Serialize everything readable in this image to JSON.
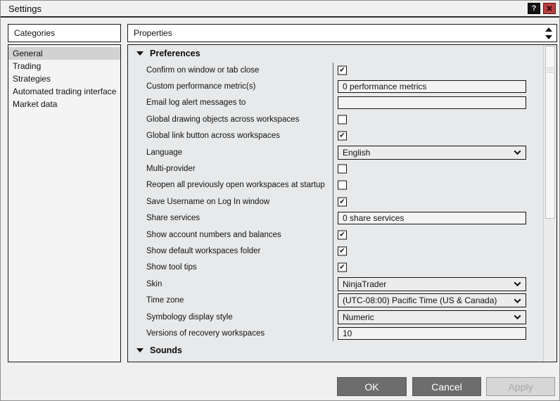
{
  "window": {
    "title": "Settings",
    "help_label": "?",
    "close_label": "✕"
  },
  "sidebar": {
    "header": "Categories",
    "items": [
      {
        "label": "General",
        "selected": true
      },
      {
        "label": "Trading",
        "selected": false
      },
      {
        "label": "Strategies",
        "selected": false
      },
      {
        "label": "Automated trading interface",
        "selected": false
      },
      {
        "label": "Market data",
        "selected": false
      }
    ]
  },
  "properties": {
    "header": "Properties",
    "sections": [
      {
        "title": "Preferences",
        "expanded": true,
        "rows": [
          {
            "label": "Confirm on window or tab close",
            "control": "checkbox",
            "value": true
          },
          {
            "label": "Custom performance metric(s)",
            "control": "text",
            "value": "0 performance metrics"
          },
          {
            "label": "Email log alert messages to",
            "control": "text",
            "value": ""
          },
          {
            "label": "Global drawing objects across workspaces",
            "control": "checkbox",
            "value": false
          },
          {
            "label": "Global link button across workspaces",
            "control": "checkbox",
            "value": true
          },
          {
            "label": "Language",
            "control": "select",
            "value": "English"
          },
          {
            "label": "Multi-provider",
            "control": "checkbox",
            "value": false
          },
          {
            "label": "Reopen all previously open workspaces at startup",
            "control": "checkbox",
            "value": false
          },
          {
            "label": "Save Username on Log In window",
            "control": "checkbox",
            "value": true
          },
          {
            "label": "Share services",
            "control": "text",
            "value": "0 share services"
          },
          {
            "label": "Show account numbers and balances",
            "control": "checkbox",
            "value": true
          },
          {
            "label": "Show default workspaces folder",
            "control": "checkbox",
            "value": true
          },
          {
            "label": "Show tool tips",
            "control": "checkbox",
            "value": true
          },
          {
            "label": "Skin",
            "control": "select",
            "value": "NinjaTrader"
          },
          {
            "label": "Time zone",
            "control": "select",
            "value": "(UTC-08:00) Pacific Time (US & Canada)"
          },
          {
            "label": "Symbology display style",
            "control": "select",
            "value": "Numeric"
          },
          {
            "label": "Versions of recovery workspaces",
            "control": "text",
            "value": "10"
          }
        ]
      },
      {
        "title": "Sounds",
        "expanded": true,
        "rows": []
      }
    ]
  },
  "footer": {
    "ok": "OK",
    "cancel": "Cancel",
    "apply": "Apply",
    "apply_enabled": false
  },
  "colors": {
    "titlebar_divider": "#2e2e2e",
    "panel_background": "#e8e9ea",
    "selection": "#d2d2d2",
    "button_dark": "#6d6d6d",
    "close_button_red": "#b64040",
    "field_border": "#141414"
  }
}
